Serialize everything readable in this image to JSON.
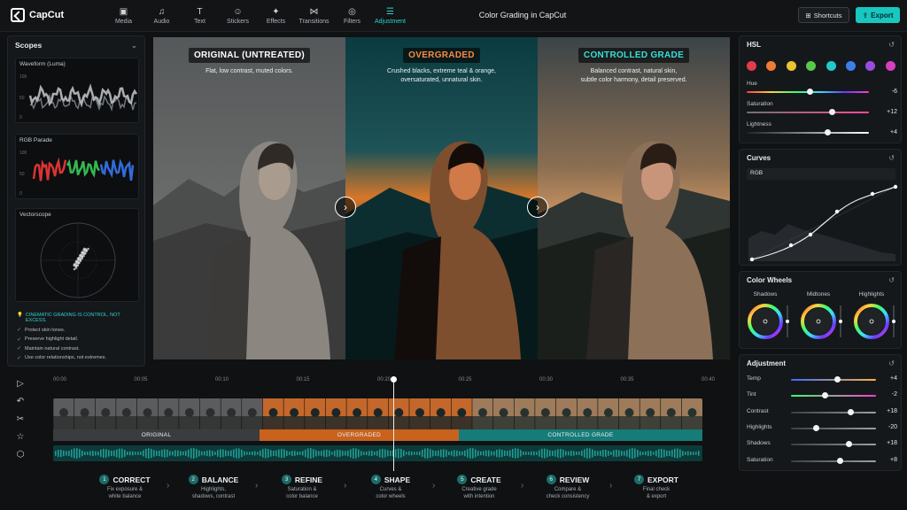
{
  "app": {
    "logo": "CapCut",
    "title": "Color Grading in CapCut"
  },
  "toolbar": {
    "items": [
      {
        "label": "Media",
        "icon": "media-icon"
      },
      {
        "label": "Audio",
        "icon": "audio-icon"
      },
      {
        "label": "Text",
        "icon": "text-icon"
      },
      {
        "label": "Stickers",
        "icon": "stickers-icon"
      },
      {
        "label": "Effects",
        "icon": "effects-icon"
      },
      {
        "label": "Transitions",
        "icon": "transitions-icon"
      },
      {
        "label": "Filters",
        "icon": "filters-icon"
      },
      {
        "label": "Adjustment",
        "icon": "adjustment-icon",
        "active": true
      }
    ],
    "shortcuts": "Shortcuts",
    "export": "Export",
    "accent": "#18c7c0"
  },
  "scopes": {
    "title": "Scopes",
    "waveform": {
      "title": "Waveform (Luma)",
      "ticks": [
        "100",
        "50",
        "0"
      ]
    },
    "parade": {
      "title": "RGB Parade",
      "ticks": [
        "100",
        "50",
        "0"
      ]
    },
    "vectorscope": {
      "title": "Vectorscope"
    },
    "tips_head": "CINEMATIC GRADING IS CONTROL, NOT EXCESS.",
    "tips": [
      "Protect skin tones.",
      "Preserve highlight detail.",
      "Maintain natural contrast.",
      "Use color relationships, not extremes."
    ]
  },
  "preview": {
    "panes": [
      {
        "label": "ORIGINAL (UNTREATED)",
        "desc": "Flat, low contrast, muted colors.",
        "color": "#ffffff"
      },
      {
        "label": "OVERGRADED",
        "desc": "Crushed blacks, extreme teal & orange,\noversaturated, unnatural skin.",
        "color": "#ff8a3d"
      },
      {
        "label": "CONTROLLED GRADE",
        "desc": "Balanced contrast, natural skin,\nsubtle color harmony, detail preserved.",
        "color": "#35e0d8"
      }
    ]
  },
  "hsl": {
    "title": "HSL",
    "swatches": [
      "#e23b4a",
      "#f07b32",
      "#e8c531",
      "#58c84a",
      "#22c9c9",
      "#3f7ee8",
      "#9a4be0",
      "#d63fc0"
    ],
    "sliders": [
      {
        "label": "Hue",
        "value": "-6",
        "level": 0.52
      },
      {
        "label": "Saturation",
        "value": "+12",
        "level": 0.7
      },
      {
        "label": "Lightness",
        "value": "+4",
        "level": 0.66
      }
    ]
  },
  "curves": {
    "title": "Curves",
    "channel": "RGB"
  },
  "wheels": {
    "title": "Color Wheels",
    "labels": [
      "Shadows",
      "Midtones",
      "Highlights"
    ]
  },
  "adjustment": {
    "title": "Adjustment",
    "sliders": [
      {
        "label": "Temp",
        "value": "+4",
        "level": 0.55
      },
      {
        "label": "Tint",
        "value": "-2",
        "level": 0.4
      },
      {
        "label": "Contrast",
        "value": "+18",
        "level": 0.7
      },
      {
        "label": "Highlights",
        "value": "-20",
        "level": 0.3
      },
      {
        "label": "Shadows",
        "value": "+18",
        "level": 0.68
      },
      {
        "label": "Saturation",
        "value": "+8",
        "level": 0.58
      }
    ]
  },
  "timeline": {
    "times": [
      "00:00",
      "00:05",
      "00:10",
      "00:15",
      "00:20",
      "00:25",
      "00:30",
      "00:35",
      "00:40"
    ],
    "segments": [
      {
        "label": "ORIGINAL",
        "color": "#3a3d40"
      },
      {
        "label": "OVERGRADED",
        "color": "#c8621d"
      },
      {
        "label": "CONTROLLED GRADE",
        "color": "#157c79"
      }
    ]
  },
  "steps": [
    {
      "num": "1",
      "title": "CORRECT",
      "sub": "Fix exposure &\nwhite balance"
    },
    {
      "num": "2",
      "title": "BALANCE",
      "sub": "Highlights,\nshadows, contrast"
    },
    {
      "num": "3",
      "title": "REFINE",
      "sub": "Saturation &\ncolor balance"
    },
    {
      "num": "4",
      "title": "SHAPE",
      "sub": "Curves &\ncolor wheels"
    },
    {
      "num": "5",
      "title": "CREATE",
      "sub": "Creative grade\nwith intention"
    },
    {
      "num": "6",
      "title": "REVIEW",
      "sub": "Compare &\ncheck consistency"
    },
    {
      "num": "7",
      "title": "EXPORT",
      "sub": "Final check\n& export"
    }
  ]
}
